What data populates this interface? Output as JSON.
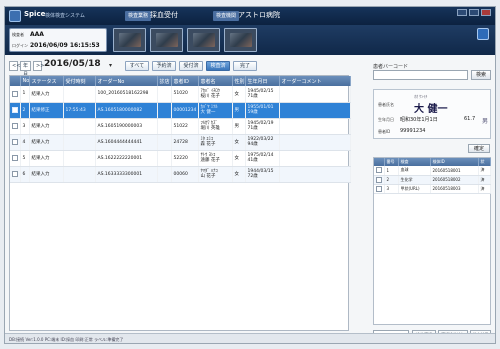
{
  "app": {
    "name": "Spice",
    "subtitle": "検体検査システム",
    "tag1": "検査業務",
    "screen": "採血受付",
    "tag2": "検査機関",
    "facility": "アストロ病院"
  },
  "user_box": {
    "user_label": "検査者",
    "user_value": "AAA",
    "date_label": "ログイン",
    "date_value": "2016/06/09 16:15:53"
  },
  "datebar": {
    "prev": "<<",
    "month": "年月",
    "next": ">>",
    "date": "2016/05/18",
    "dropdown": "▾",
    "filters": [
      {
        "label": "すべて",
        "active": false
      },
      {
        "label": "予約済",
        "active": false
      },
      {
        "label": "受付済",
        "active": false
      },
      {
        "label": "検査済",
        "active": true
      },
      {
        "label": "完了",
        "active": false
      }
    ]
  },
  "grid": {
    "headers": [
      "",
      "No",
      "ステータス",
      "受付時刻",
      "オーダーNo",
      "診店",
      "患者ID",
      "患者名",
      "性別",
      "生年月日",
      "オーダーコメント"
    ],
    "rows": [
      {
        "no": "1",
        "status": "結果入力",
        "time": "",
        "order": "100_20160518162298",
        "dept": "",
        "pid": "51020",
        "name_kana": "ｱｶﾊﾞ ｲﾁﾛｳ",
        "name": "桜川 花子",
        "sex": "女",
        "dob": "1945/02/15",
        "age": "71歳",
        "comment": ""
      },
      {
        "no": "2",
        "status": "結果修正",
        "time": "17:55:43",
        "order": "AS.1605180000082",
        "dept": "",
        "pid": "00001234",
        "name_kana": "ｶﾊﾞﾔ ﾐﾂﾙ",
        "name": "大 健一",
        "sex": "男",
        "dob": "1955/01/01",
        "age": "59歳",
        "comment": ""
      },
      {
        "no": "3",
        "status": "結果入力",
        "time": "",
        "order": "AS.1605190000003",
        "dept": "",
        "pid": "51022",
        "name_kana": "ﾌﾙｶﾜ ｶｽﾞ",
        "name": "堀川 英雄",
        "sex": "男",
        "dob": "1945/02/19",
        "age": "71歳",
        "comment": ""
      },
      {
        "no": "4",
        "status": "結果入力",
        "time": "",
        "order": "AS.1604444444441",
        "dept": "",
        "pid": "24728",
        "name_kana": "ﾐﾀ ﾕﾐｺ",
        "name": "森 花子",
        "sex": "女",
        "dob": "1922/03/22",
        "age": "94歳",
        "comment": ""
      },
      {
        "no": "5",
        "status": "結果入力",
        "time": "",
        "order": "AS.1622222220001",
        "dept": "",
        "pid": "52220",
        "name_kana": "ｻﾄｳ ﾖｼｺ",
        "name": "遠藤 花子",
        "sex": "女",
        "dob": "1975/02/14",
        "age": "41歳",
        "comment": ""
      },
      {
        "no": "6",
        "status": "結果入力",
        "time": "",
        "order": "AS.1633333300001",
        "dept": "",
        "pid": "00060",
        "name_kana": "ﾔﾏﾀﾞ ﾊﾅｺ",
        "name": "山 花子",
        "sex": "女",
        "dob": "1944/03/15",
        "age": "72歳",
        "comment": ""
      }
    ]
  },
  "right": {
    "barcode_label": "患者バーコード",
    "barcode_placeholder": "",
    "search_label": "検索",
    "card": {
      "name_label": "患者氏名",
      "name_kana": "ｵｵ ｹﾝｲﾁ",
      "name": "大 健一",
      "dob_label": "生年月日",
      "dob": "昭和30年1月1日",
      "weight": "61.7",
      "sex_icon": "男",
      "pid_label": "患者ID",
      "pid": "99991234"
    },
    "clear_label": "確定",
    "headers": [
      "",
      "番号",
      "検査",
      "検体ID",
      "状"
    ],
    "rows": [
      {
        "no": "1",
        "name": "血球",
        "sid": "20160518001",
        "st": "済"
      },
      {
        "no": "2",
        "name": "生化学",
        "sid": "20160518002",
        "st": "済"
      },
      {
        "no": "3",
        "name": "甲状(URL)",
        "sid": "20160518003",
        "st": "済"
      }
    ],
    "bottom_select": "▾",
    "buttons": [
      "検体選択",
      "選択検体追加",
      "検査結果"
    ]
  },
  "status": "DB:接続  Ver:1.0.0  PC:端末  ID:採血  印刷:正常  ラベル:準備完了"
}
